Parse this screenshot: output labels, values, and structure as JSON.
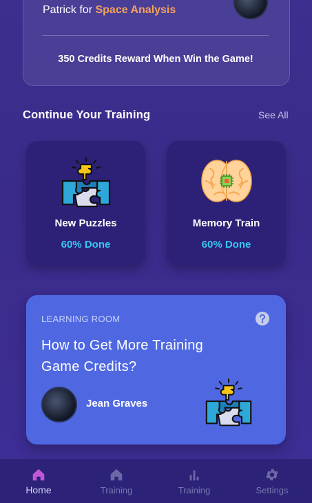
{
  "challenge": {
    "name": "Patrick",
    "connector": " for ",
    "highlight": "Space Analysis",
    "reward": "350 Credits Reward When Win the Game!"
  },
  "training": {
    "title": "Continue Your Training",
    "see_all": "See All",
    "cards": [
      {
        "title": "New Puzzles",
        "progress": "60% Done",
        "icon": "puzzle-icon"
      },
      {
        "title": "Memory Train",
        "progress": "60% Done",
        "icon": "brain-icon"
      }
    ]
  },
  "learning": {
    "label": "LEARNING ROOM",
    "title": "How to Get More Training Game Credits?",
    "author": "Jean Graves",
    "help_icon": "help-icon",
    "icon": "puzzle-icon"
  },
  "nav": {
    "items": [
      {
        "label": "Home",
        "icon": "home-icon",
        "active": true
      },
      {
        "label": "Training",
        "icon": "home-icon",
        "active": false
      },
      {
        "label": "Training",
        "icon": "bar-chart-icon",
        "active": false
      },
      {
        "label": "Settings",
        "icon": "gear-icon",
        "active": false
      }
    ]
  },
  "colors": {
    "background": "#3b2f8f",
    "card": "#2c2177",
    "accent_orange": "#f7a25a",
    "progress": "#39c7ef",
    "learning_card": "#4f68e2",
    "nav_active": "#c356d6"
  }
}
